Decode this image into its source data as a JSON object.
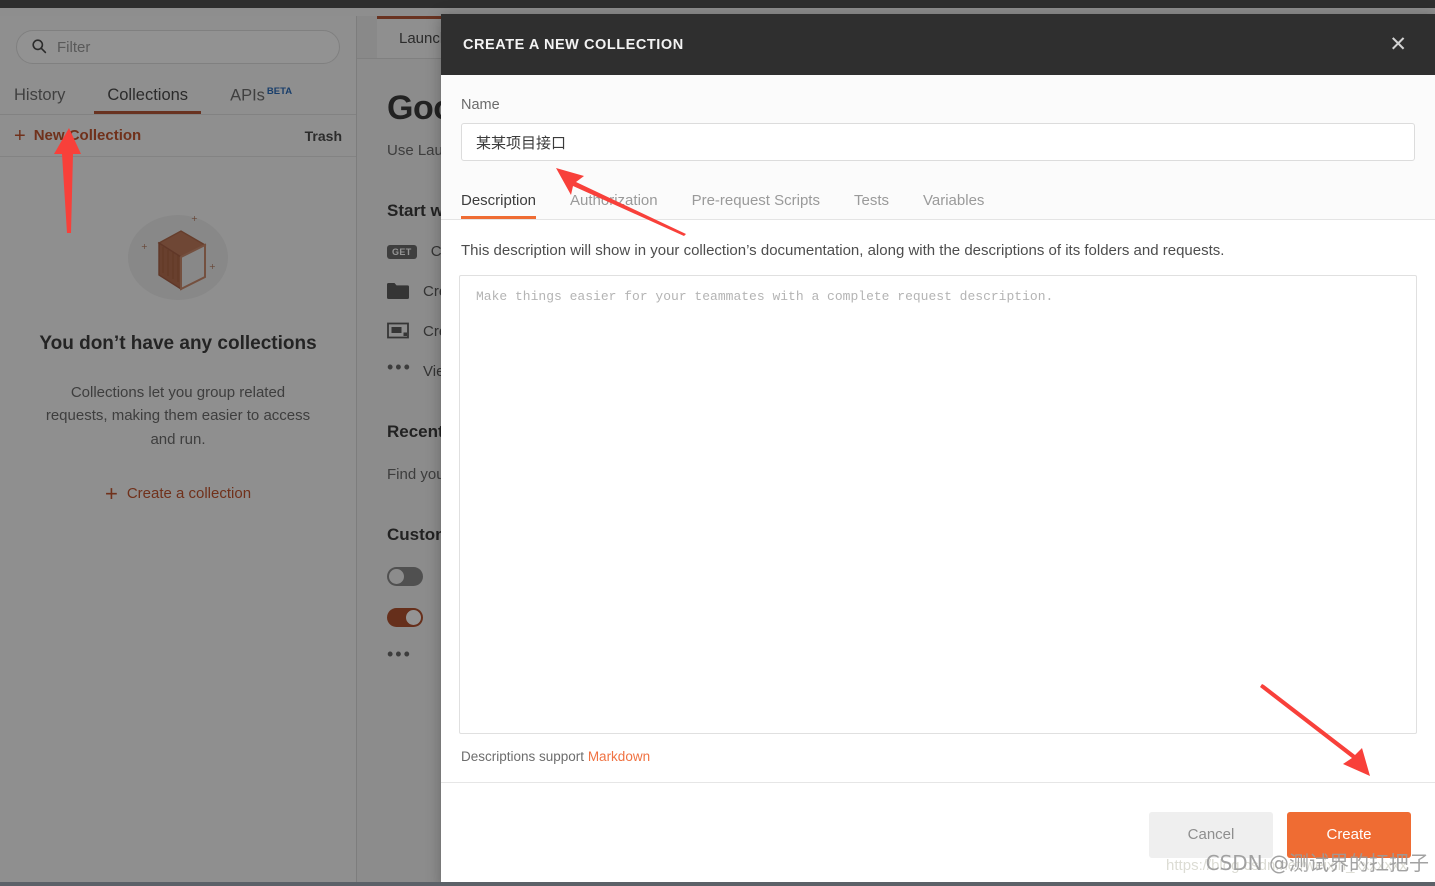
{
  "window": {
    "top_strip_color": "#2e2e2e"
  },
  "sidebar": {
    "search": {
      "placeholder": "Filter",
      "icon": "search-icon"
    },
    "tabs": [
      {
        "label": "History",
        "active": false
      },
      {
        "label": "Collections",
        "active": true
      },
      {
        "label": "APIs",
        "active": false,
        "badge": "BETA"
      }
    ],
    "new_collection_label": "New Collection",
    "trash_label": "Trash",
    "empty_state": {
      "title": "You don’t have any collections",
      "text": "Collections let you group related requests, making them easier to access and run.",
      "cta": "Create a collection"
    }
  },
  "main": {
    "tab_label": "Launchpad",
    "greeting": "Good morning",
    "subgreeting": "Use Launchpad",
    "sections": {
      "start_title": "Start with something new",
      "start_items": [
        {
          "badge": "GET",
          "label": "Create a request",
          "icon": "get-badge"
        },
        {
          "badge": "",
          "label": "Create a collection",
          "icon": "folder-icon"
        },
        {
          "badge": "",
          "label": "Create an environment",
          "icon": "monitor-icon"
        },
        {
          "badge": "",
          "label": "View more actions",
          "icon": "ellipsis-icon"
        }
      ],
      "recent_title": "Recently visited",
      "recent_text": "Find your recent work here",
      "customize_title": "Customize your workspace",
      "toggles": [
        {
          "on": false,
          "label": ""
        },
        {
          "on": true,
          "label": ""
        }
      ],
      "more_icon": "ellipsis-icon"
    }
  },
  "modal": {
    "title": "CREATE A NEW COLLECTION",
    "close_icon": "close-icon",
    "name_label": "Name",
    "name_value": "某某项目接口",
    "name_placeholder": "Name",
    "tabs": [
      {
        "label": "Description",
        "active": true
      },
      {
        "label": "Authorization",
        "active": false
      },
      {
        "label": "Pre-request Scripts",
        "active": false
      },
      {
        "label": "Tests",
        "active": false
      },
      {
        "label": "Variables",
        "active": false
      }
    ],
    "description_note": "This description will show in your collection’s documentation, along with the descriptions of its folders and requests.",
    "description_value": "",
    "description_placeholder": "Make things easier for your teammates with a complete request description.",
    "markdown_prefix": "Descriptions support ",
    "markdown_link": "Markdown",
    "buttons": {
      "cancel": "Cancel",
      "create": "Create"
    }
  },
  "annotations": {
    "arrow_color": "#f8403a",
    "arrows": [
      {
        "name": "arrow-to-new-collection",
        "direction": "up"
      },
      {
        "name": "arrow-to-name-field",
        "direction": "up-left"
      },
      {
        "name": "arrow-to-create-button",
        "direction": "down-right"
      }
    ]
  },
  "watermark": {
    "text": "CSDN @测试界的扛把子",
    "faint_text": "https://blog.csdn.net/weixin_xxxxxxx"
  },
  "colors": {
    "accent_orange": "#ef6c33",
    "link_orange": "#c2552f",
    "modal_header": "#2f2f2f",
    "beta_blue": "#2b6cb8"
  }
}
